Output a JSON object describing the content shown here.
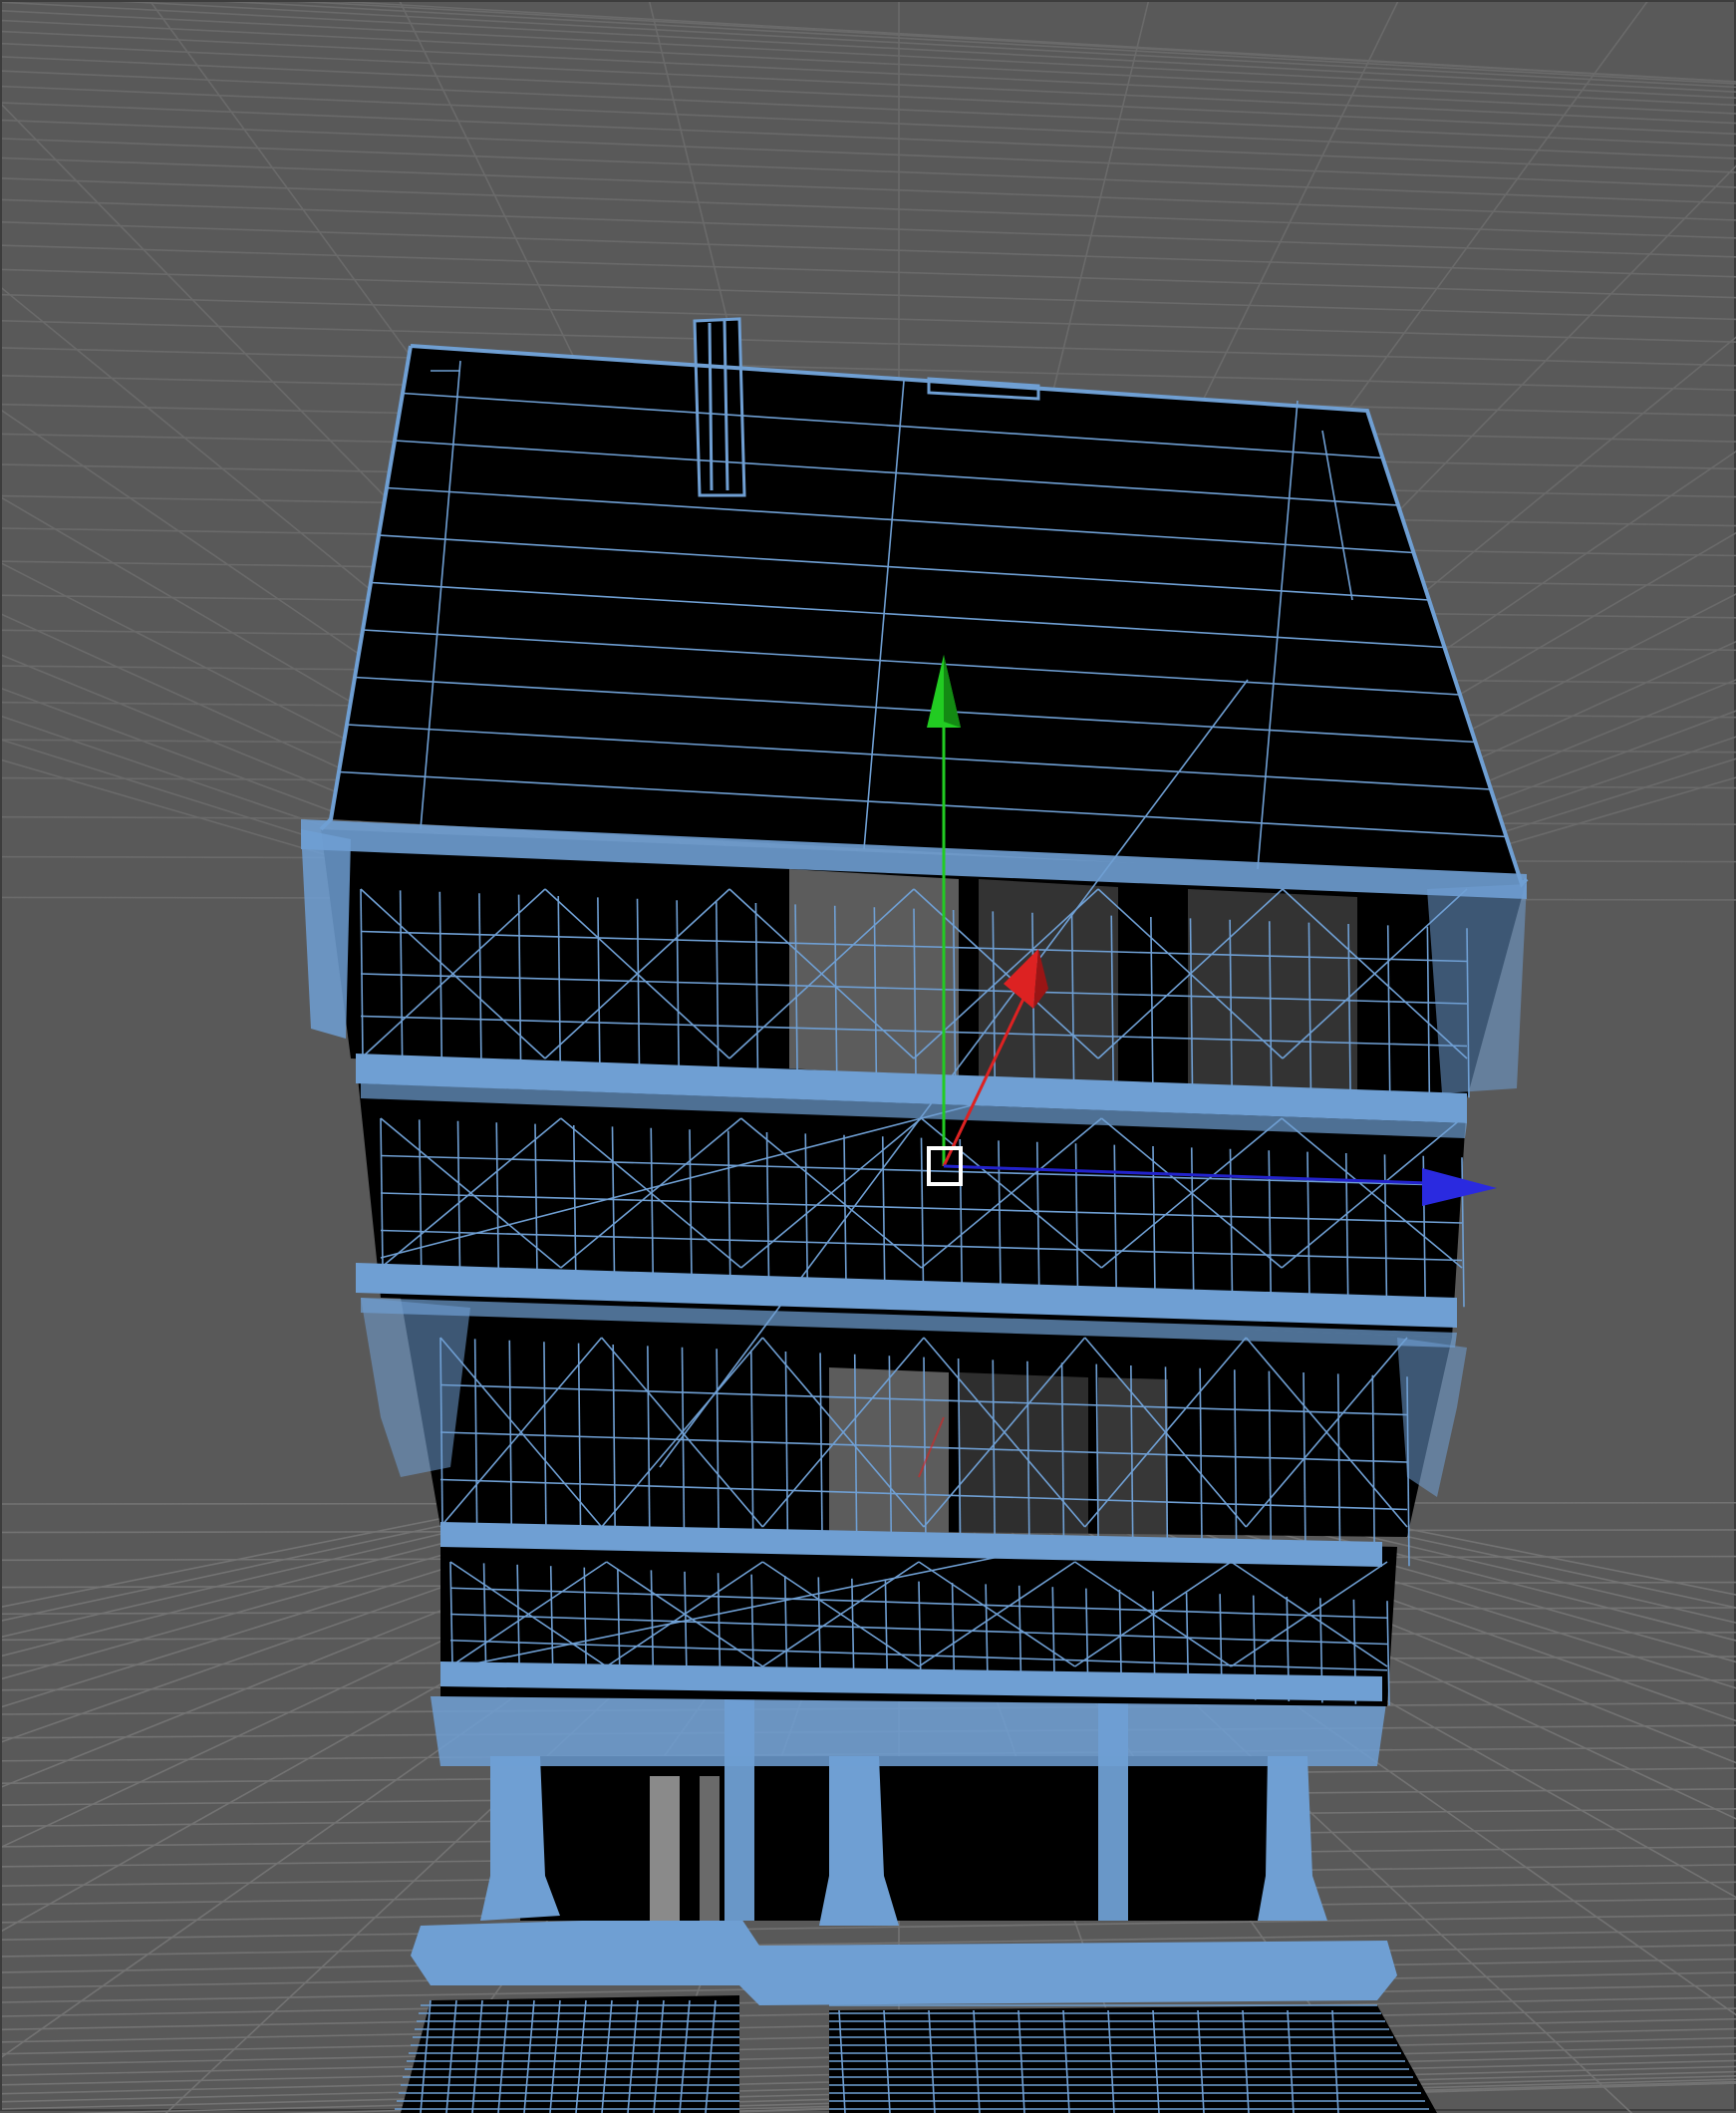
{
  "viewport": {
    "background": "#595959",
    "grid_color": "#6a6a6a",
    "wireframe_color": "#6f9fd3",
    "model_fill": "#000000"
  },
  "gizmo": {
    "type": "move",
    "axes": [
      {
        "axis": "y",
        "color": "#22cc22",
        "icon": "arrow-up-icon"
      },
      {
        "axis": "x",
        "color": "#dd2222",
        "icon": "arrow-diagonal-icon"
      },
      {
        "axis": "z",
        "color": "#2222cc",
        "icon": "arrow-right-icon"
      }
    ],
    "center_handle_color": "#ffffff"
  },
  "model": {
    "kind": "half-timbered house",
    "display_mode": "wireframe-on-shaded"
  }
}
